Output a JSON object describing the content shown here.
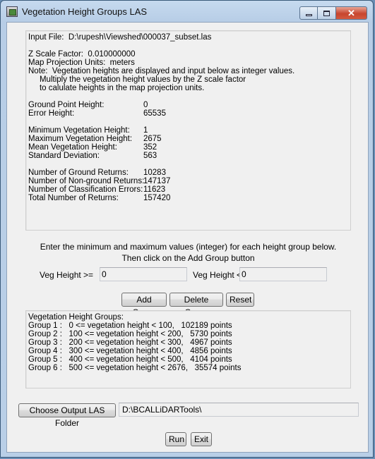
{
  "window": {
    "title": "Vegetation Height Groups LAS",
    "controls": {
      "minimize": "▭",
      "maximize": "▢",
      "close": "✕"
    }
  },
  "info": {
    "input_file": "Input File:  D:\\rupesh\\Viewshed\\000037_subset.las",
    "z_scale": "Z Scale Factor:  0.010000000",
    "projection_units": "Map Projection Units:  meters",
    "note_1": "Note:  Vegetation heights are displayed and input below as integer values.",
    "note_2": "     Multiply the vegetation height values by the Z scale factor",
    "note_3": "     to calulate heights in the map projection units.",
    "stats_a": [
      {
        "label": "Ground Point Height:",
        "value": "0"
      },
      {
        "label": "Error Height:",
        "value": "65535"
      }
    ],
    "stats_b": [
      {
        "label": "Minimum Vegetation Height:",
        "value": "1"
      },
      {
        "label": "Maximum Vegetation Height:",
        "value": "2675"
      },
      {
        "label": "Mean Vegetation Height:",
        "value": "352"
      },
      {
        "label": "Standard Deviation:",
        "value": "563"
      }
    ],
    "stats_c": [
      {
        "label": "Number of Ground Returns:",
        "value": "10283"
      },
      {
        "label": "Number of Non-ground Returns:",
        "value": "147137"
      },
      {
        "label": "Number of Classification Errors:",
        "value": "11623"
      },
      {
        "label": "Total Number of Returns:",
        "value": "157420"
      }
    ]
  },
  "instructions": {
    "line1": "Enter the minimum and maximum values (integer) for each height group below.",
    "line2": "Then click on the Add Group button"
  },
  "inputs": {
    "min_label": "Veg Height >=",
    "min_value": "0",
    "max_label": "Veg Height <",
    "max_value": "0"
  },
  "buttons": {
    "add_group": "Add Group",
    "delete_group": "Delete Group",
    "reset": "Reset",
    "choose_folder": "Choose Output LAS Folder",
    "run": "Run",
    "exit": "Exit"
  },
  "groups": {
    "heading": "Vegetation Height Groups:",
    "items": [
      "Group 1 :   0 <= vegetation height < 100,   102189 points",
      "Group 2 :   100 <= vegetation height < 200,   5730 points",
      "Group 3 :   200 <= vegetation height < 300,   4967 points",
      "Group 4 :   300 <= vegetation height < 400,   4856 points",
      "Group 5 :   400 <= vegetation height < 500,   4104 points",
      "Group 6 :   500 <= vegetation height < 2676,   35574 points"
    ]
  },
  "output_folder": "D:\\BCALLiDARTools\\"
}
